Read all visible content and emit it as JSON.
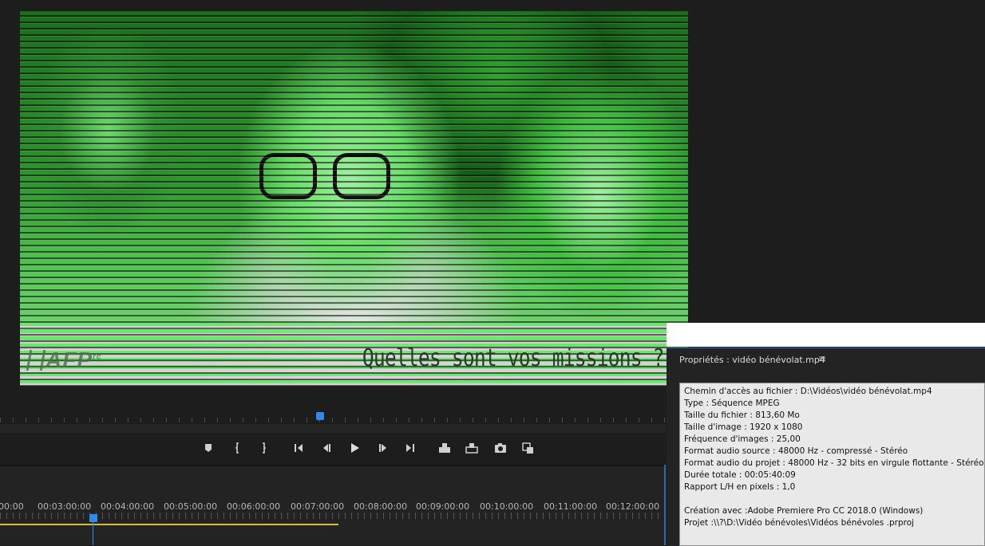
{
  "video": {
    "caption": "Quelles sont vos missions ?",
    "logo_text": "AFP",
    "logo_superscript": "rc"
  },
  "transport": {
    "controls": [
      {
        "name": "add-marker-button",
        "icon": "marker-icon"
      },
      {
        "name": "mark-in-button",
        "icon": "mark-in-icon"
      },
      {
        "name": "mark-out-button",
        "icon": "mark-out-icon"
      },
      {
        "name": "go-to-in-button",
        "icon": "go-to-in-icon"
      },
      {
        "name": "step-back-button",
        "icon": "step-back-icon"
      },
      {
        "name": "play-button",
        "icon": "play-icon"
      },
      {
        "name": "step-forward-button",
        "icon": "step-forward-icon"
      },
      {
        "name": "go-to-out-button",
        "icon": "go-to-out-icon"
      },
      {
        "name": "insert-button",
        "icon": "insert-icon"
      },
      {
        "name": "overwrite-button",
        "icon": "overwrite-icon"
      },
      {
        "name": "export-frame-button",
        "icon": "camera-icon"
      },
      {
        "name": "button-editor-button",
        "icon": "plus-icon"
      }
    ]
  },
  "timeline": {
    "timecodes": [
      "00:00",
      "00:03:00:00",
      "00:04:00:00",
      "00:05:00:00",
      "00:06:00:00",
      "00:07:00:00",
      "00:08:00:00",
      "00:09:00:00",
      "00:10:00:00",
      "00:11:00:00",
      "00:12:00:00"
    ],
    "accent_color": "#2d8ceb",
    "work_area_color": "#d4c02a"
  },
  "properties": {
    "title": "Propriétés : vidéo bénévolat.mp4",
    "menu_icon": "hamburger-icon",
    "lines": [
      "Chemin d'accès au fichier : D:\\Vidéos\\vidéo bénévolat.mp4",
      "Type : Séquence MPEG",
      "Taille du fichier : 813,60 Mo",
      "Taille d'image : 1920 x 1080",
      "Fréquence d'images : 25,00",
      "Format audio source : 48000 Hz - compressé - Stéréo",
      "Format audio du projet : 48000 Hz - 32 bits en virgule flottante - Stéréo",
      "Durée totale : 00:05:40:09",
      "Rapport L/H en pixels : 1,0"
    ],
    "lines_after_gap": [
      "Création avec :Adobe Premiere Pro CC 2018.0 (Windows)",
      "Projet :\\\\?\\D:\\Vidéo bénévoles\\Vidéos bénévoles .prproj"
    ]
  }
}
